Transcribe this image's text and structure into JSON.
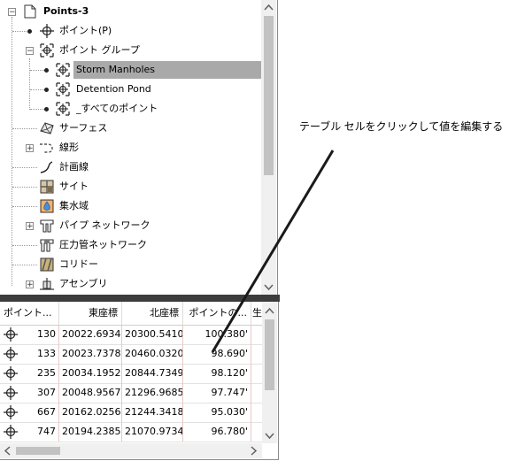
{
  "tree": {
    "root": "Points-3",
    "items": [
      {
        "label": "ポイント(P)",
        "icon": "point-icon"
      },
      {
        "label": "ポイント グループ",
        "icon": "point-group-icon"
      },
      {
        "label": "Storm Manholes",
        "icon": "point-group-icon",
        "selected": true
      },
      {
        "label": "Detention Pond",
        "icon": "point-group-icon"
      },
      {
        "label": "_すべてのポイント",
        "icon": "point-group-icon"
      },
      {
        "label": "サーフェス",
        "icon": "surface-icon"
      },
      {
        "label": "線形",
        "icon": "alignment-icon"
      },
      {
        "label": "計画線",
        "icon": "feature-line-icon"
      },
      {
        "label": "サイト",
        "icon": "site-icon"
      },
      {
        "label": "集水域",
        "icon": "catchment-icon"
      },
      {
        "label": "パイプ ネットワーク",
        "icon": "pipe-network-icon"
      },
      {
        "label": "圧力管ネットワーク",
        "icon": "pressure-network-icon"
      },
      {
        "label": "コリドー",
        "icon": "corridor-icon"
      },
      {
        "label": "アセンブリ",
        "icon": "assembly-icon"
      }
    ]
  },
  "grid": {
    "columns": [
      "ポイント...",
      "東座標",
      "北座標",
      "ポイントの...",
      "生"
    ],
    "rows": [
      {
        "number": "130",
        "easting": "20022.6934'",
        "northing": "20300.5410'",
        "elevation": "100.380'"
      },
      {
        "number": "133",
        "easting": "20023.7378'",
        "northing": "20460.0320'",
        "elevation": "98.690'"
      },
      {
        "number": "235",
        "easting": "20034.1952'",
        "northing": "20844.7349'",
        "elevation": "98.120'"
      },
      {
        "number": "307",
        "easting": "20048.9567'",
        "northing": "21296.9685'",
        "elevation": "97.747'"
      },
      {
        "number": "667",
        "easting": "20162.0256'",
        "northing": "21244.3418'",
        "elevation": "95.030'"
      },
      {
        "number": "747",
        "easting": "20194.2385'",
        "northing": "21070.9734'",
        "elevation": "96.780'"
      }
    ]
  },
  "callout": {
    "text": "テーブル セルをクリックして値を編集する"
  },
  "colors": {
    "selection": "#a9a9a9",
    "splitter": "#3c3c3c",
    "scroll_track": "#f0f0f0",
    "scroll_thumb": "#c2c2c2"
  }
}
